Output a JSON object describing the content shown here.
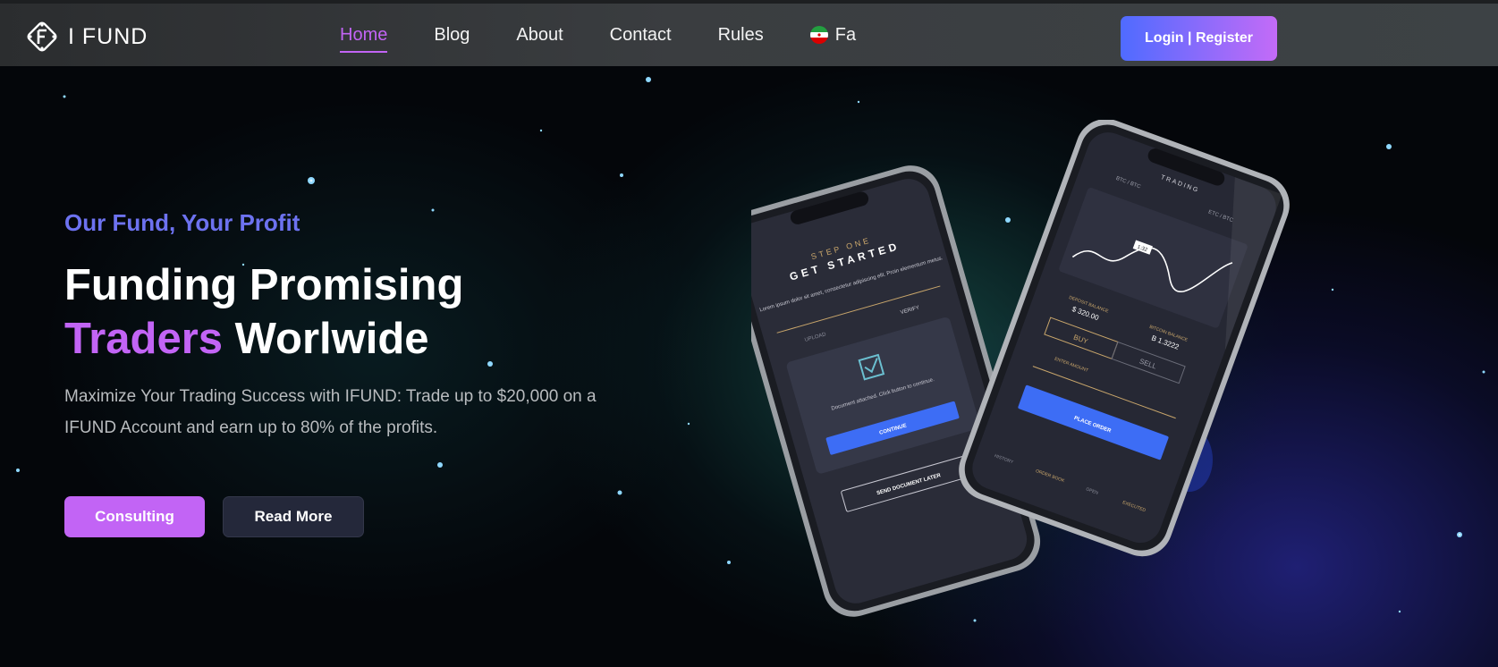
{
  "brand": {
    "logo_text": "I FUND",
    "accent": "#c264f5",
    "blue": "#4f6bff"
  },
  "nav": {
    "items": [
      "Home",
      "Blog",
      "About",
      "Contact",
      "Rules"
    ],
    "language": "Fa",
    "active": "Home"
  },
  "header": {
    "login_label": "Login | Register"
  },
  "hero": {
    "tagline": "Our Fund, Your Profit",
    "headline_line1": "Funding Promising",
    "headline_accent": "Traders",
    "headline_rest": " Worlwide",
    "description": "Maximize Your Trading Success with IFUND: Trade up to $20,000 on a IFUND Account and earn up to 80% of the profits.",
    "primary_button": "Consulting",
    "secondary_button": "Read More"
  },
  "phone_left": {
    "step": "STEP ONE",
    "title": "GET STARTED",
    "body": "Lorem ipsum dolor sit amet, consectetur adipiscing elit. Proin elementum metus.",
    "tabs": [
      "UPLOAD",
      "VERIFY"
    ],
    "doc_text": "Document attached. Click button to continue.",
    "continue_label": "CONTINUE",
    "later_label": "SEND DOCUMENT LATER"
  },
  "phone_right": {
    "title": "TRADING",
    "pairs": [
      "BTC / BTC",
      "ETC / BTC"
    ],
    "chart_label": "1:32",
    "deposit_label": "DEPOSIT BALANCE",
    "deposit_value": "$ 320.00",
    "bitcoin_label": "BITCOIN BALANCE",
    "bitcoin_value": "B 1.3222",
    "buy_label": "BUY",
    "sell_label": "SELL",
    "amount_label": "ENTER AMOUNT",
    "place_label": "PLACE ORDER",
    "footer_tabs": [
      "HISTORY",
      "ORDER BOOK",
      "OPEN",
      "EXECUTED"
    ]
  },
  "icons": [
    "logo-icon",
    "iran-flag-icon",
    "check-icon"
  ]
}
